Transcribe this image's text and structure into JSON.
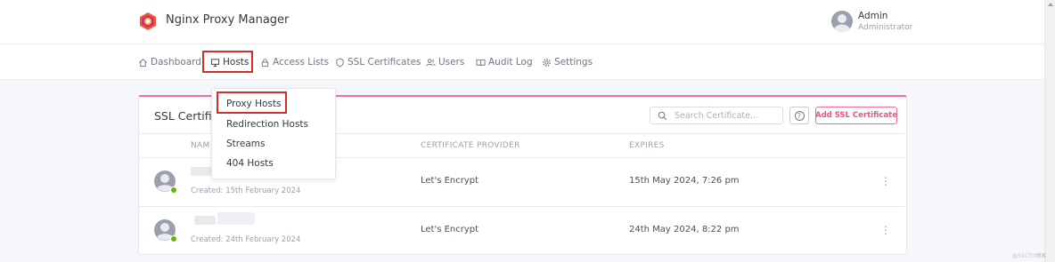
{
  "app": {
    "title": "Nginx Proxy Manager"
  },
  "user": {
    "name": "Admin",
    "role": "Administrator"
  },
  "nav": [
    {
      "label": "Dashboard",
      "icon": "home-icon"
    },
    {
      "label": "Hosts",
      "icon": "monitor-icon"
    },
    {
      "label": "Access Lists",
      "icon": "lock-icon"
    },
    {
      "label": "SSL Certificates",
      "icon": "shield-icon"
    },
    {
      "label": "Users",
      "icon": "users-icon"
    },
    {
      "label": "Audit Log",
      "icon": "book-icon"
    },
    {
      "label": "Settings",
      "icon": "gear-icon"
    }
  ],
  "hosts_menu": [
    "Proxy Hosts",
    "Redirection Hosts",
    "Streams",
    "404 Hosts"
  ],
  "card": {
    "title": "SSL Certific",
    "search_placeholder": "Search Certificate...",
    "help_label": "?",
    "add_label": "Add SSL Certificate",
    "columns": [
      "NAME",
      "CERTIFICATE PROVIDER",
      "EXPIRES"
    ],
    "column_visible": [
      "NAM"
    ],
    "rows": [
      {
        "created": "Created: 15th February 2024",
        "provider": "Let's Encrypt",
        "expires": "15th May 2024, 7:26 pm",
        "menu": "⋮"
      },
      {
        "created": "Created: 24th February 2024",
        "provider": "Let's Encrypt",
        "expires": "24th May 2024, 8:22 pm",
        "menu": "⋮"
      }
    ]
  },
  "watermark": "@51CTO博客",
  "colors": {
    "accent": "#f66d9b",
    "highlight": "#d32f2f",
    "status": "#5eba00"
  }
}
